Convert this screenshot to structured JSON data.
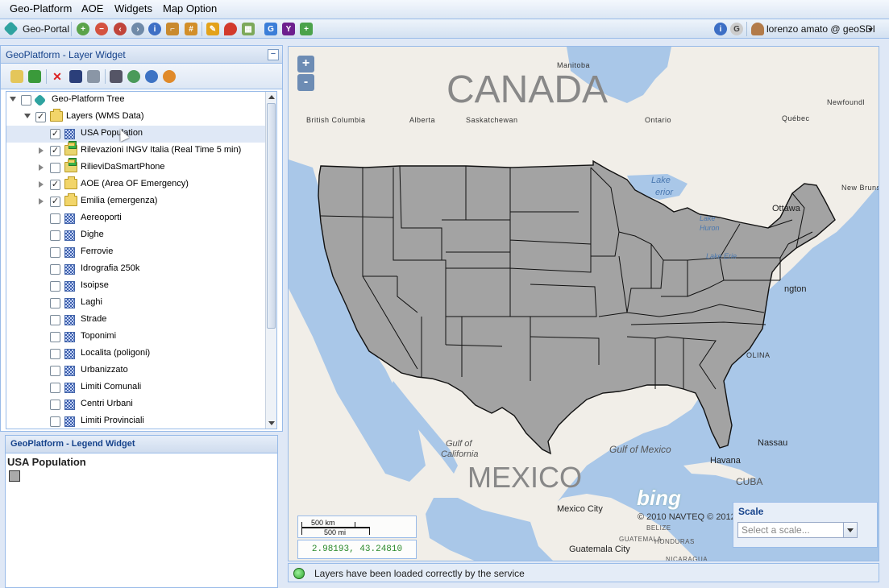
{
  "menubar": {
    "items": [
      "Geo-Platform",
      "AOE",
      "Widgets",
      "Map Option"
    ]
  },
  "toolbar": {
    "portal_label": "Geo-Portal",
    "user_label": "lorenzo amato @ geoSDI",
    "tools": [
      "zoom-in-icon",
      "zoom-out-icon",
      "zoom-previous-icon",
      "zoom-next-icon",
      "info-icon",
      "measure-icon",
      "measure-area-icon",
      "edit-pencil-icon",
      "map-marker-icon",
      "map-layers-icon",
      "google-icon",
      "yahoo-icon",
      "plus-icon"
    ]
  },
  "layer_widget": {
    "title": "GeoPlatform - Layer Widget",
    "collapse_symbol": "−",
    "tree": [
      {
        "label": "Geo-Platform Tree",
        "level": 0,
        "checked": false,
        "type": "root",
        "expand": "open"
      },
      {
        "label": "Layers (WMS Data)",
        "level": 1,
        "checked": true,
        "type": "folder",
        "expand": "open"
      },
      {
        "label": "USA Population",
        "level": 2,
        "checked": true,
        "type": "layer",
        "expand": "none",
        "selected": true
      },
      {
        "label": "Rilevazioni INGV Italia (Real Time 5 min)",
        "level": 2,
        "checked": true,
        "type": "folder-green",
        "expand": "closed"
      },
      {
        "label": "RilieviDaSmartPhone",
        "level": 2,
        "checked": false,
        "type": "folder-green",
        "expand": "closed"
      },
      {
        "label": "AOE (Area OF Emergency)",
        "level": 2,
        "checked": true,
        "type": "folder",
        "expand": "closed"
      },
      {
        "label": "Emilia (emergenza)",
        "level": 2,
        "checked": true,
        "type": "folder",
        "expand": "closed"
      },
      {
        "label": "Aereoporti",
        "level": 2,
        "checked": false,
        "type": "layer",
        "expand": "none"
      },
      {
        "label": "Dighe",
        "level": 2,
        "checked": false,
        "type": "layer",
        "expand": "none"
      },
      {
        "label": "Ferrovie",
        "level": 2,
        "checked": false,
        "type": "layer",
        "expand": "none"
      },
      {
        "label": "Idrografia 250k",
        "level": 2,
        "checked": false,
        "type": "layer",
        "expand": "none"
      },
      {
        "label": "Isoipse",
        "level": 2,
        "checked": false,
        "type": "layer",
        "expand": "none"
      },
      {
        "label": "Laghi",
        "level": 2,
        "checked": false,
        "type": "layer",
        "expand": "none"
      },
      {
        "label": "Strade",
        "level": 2,
        "checked": false,
        "type": "layer",
        "expand": "none"
      },
      {
        "label": "Toponimi",
        "level": 2,
        "checked": false,
        "type": "layer",
        "expand": "none"
      },
      {
        "label": "Localita (poligoni)",
        "level": 2,
        "checked": false,
        "type": "layer",
        "expand": "none"
      },
      {
        "label": "Urbanizzato",
        "level": 2,
        "checked": false,
        "type": "layer",
        "expand": "none"
      },
      {
        "label": "Limiti Comunali",
        "level": 2,
        "checked": false,
        "type": "layer",
        "expand": "none"
      },
      {
        "label": "Centri Urbani",
        "level": 2,
        "checked": false,
        "type": "layer",
        "expand": "none"
      },
      {
        "label": "Limiti Provinciali",
        "level": 2,
        "checked": false,
        "type": "layer",
        "expand": "none"
      }
    ]
  },
  "legend_widget": {
    "title": "GeoPlatform - Legend Widget",
    "layer_title": "USA Population",
    "swatch_color": "#a9a9a9"
  },
  "map": {
    "zoom_in": "+",
    "zoom_out": "-",
    "place_labels": {
      "canada": "CANADA",
      "mexico": "MEXICO",
      "manitoba": "Manitoba",
      "british_columbia": "British Columbia",
      "alberta": "Alberta",
      "saskatchewan": "Saskatchewan",
      "ontario": "Ontario",
      "quebec": "Québec",
      "newfoundland": "Newfoundl",
      "new_brunswick": "New Brunsv",
      "ottawa": "Ottawa",
      "washington": "ngton",
      "carolina": "OLINA",
      "lake_superior_a": "Lake",
      "lake_superior_b": "erior",
      "lake_huron_a": "Lake",
      "lake_huron_b": "Huron",
      "lake_erie": "Lake Erie",
      "gulf_of_california_a": "Gulf of",
      "gulf_of_california_b": "California",
      "gulf_of_mexico": "Gulf of Mexico",
      "nassau": "Nassau",
      "havana": "Havana",
      "cuba": "CUBA",
      "mexico_city": "Mexico City",
      "guatemala_city": "Guatemala City",
      "belize": "BELIZE",
      "guatemala": "GUATEMALA",
      "honduras": "HONDURAS",
      "nicaragua": "NICARAGUA"
    },
    "bing_logo": "bing",
    "copyright": "© 2010 NAVTEQ © 2012",
    "scale_km": "500 km",
    "scale_mi": "500 mi",
    "coordinates": "2.98193, 43.24810",
    "state_fill": "#a3a3a3",
    "land_color": "#f1eee8",
    "water_color": "#a9c7e8"
  },
  "scale_widget": {
    "title": "Scale",
    "placeholder": "Select a scale..."
  },
  "status": {
    "text": "Layers have been loaded correctly by the service",
    "color": "#2ea52e"
  }
}
